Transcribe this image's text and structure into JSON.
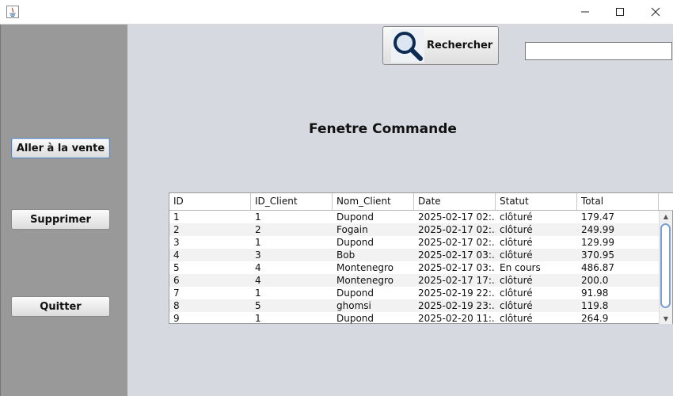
{
  "window": {
    "controls": {
      "minimize": "—",
      "maximize": "☐",
      "close": "✕"
    },
    "app_icon": "java-icon"
  },
  "sidebar": {
    "buttons": [
      {
        "label": "Aller à la vente"
      },
      {
        "label": "Supprimer"
      },
      {
        "label": "Quitter"
      }
    ]
  },
  "toolbar": {
    "search_label": "Rechercher",
    "search_icon": "magnifier-icon",
    "search_value": ""
  },
  "main": {
    "title": "Fenetre Commande"
  },
  "table": {
    "columns": [
      "ID",
      "ID_Client",
      "Nom_Client",
      "Date",
      "Statut",
      "Total"
    ],
    "rows": [
      [
        "1",
        "1",
        "Dupond",
        "2025-02-17 02:...",
        "clôturé",
        "179.47"
      ],
      [
        "2",
        "2",
        "Fogain",
        "2025-02-17 02:...",
        "clôturé",
        "249.99"
      ],
      [
        "3",
        "1",
        "Dupond",
        "2025-02-17 02:...",
        "clôturé",
        "129.99"
      ],
      [
        "4",
        "3",
        "Bob",
        "2025-02-17 03:...",
        "clôturé",
        "370.95"
      ],
      [
        "5",
        "4",
        "Montenegro",
        "2025-02-17 03:...",
        "En cours",
        "486.87"
      ],
      [
        "6",
        "4",
        "Montenegro",
        "2025-02-17 17:...",
        "clôturé",
        "200.0"
      ],
      [
        "7",
        "1",
        "Dupond",
        "2025-02-19 22:...",
        "clôturé",
        "91.98"
      ],
      [
        "8",
        "5",
        "ghomsi",
        "2025-02-19 23:...",
        "clôturé",
        "119.8"
      ],
      [
        "9",
        "1",
        "Dupond",
        "2025-02-20 11:...",
        "clôturé",
        "264.9"
      ]
    ]
  },
  "colors": {
    "sidebar_bg": "#999999",
    "main_bg": "#d6d9df",
    "focus_border": "#5c86b5",
    "scroll_thumb": "#7d9fd0"
  }
}
